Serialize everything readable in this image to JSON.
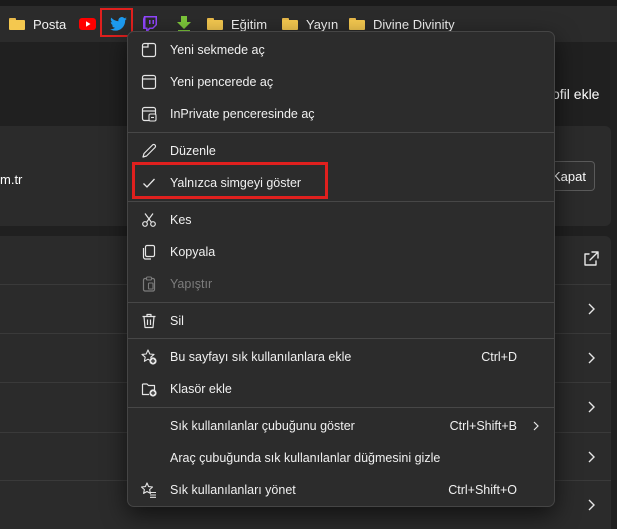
{
  "favorites_bar": {
    "items": [
      {
        "label": "Posta",
        "icon": "folder-icon"
      },
      {
        "label": "",
        "icon": "youtube-icon"
      },
      {
        "label": "",
        "icon": "twitter-icon"
      },
      {
        "label": "",
        "icon": "twitch-icon"
      },
      {
        "label": "",
        "icon": "download-arrow-icon"
      },
      {
        "label": "Eğitim",
        "icon": "folder-icon"
      },
      {
        "label": "Yayın",
        "icon": "folder-icon"
      },
      {
        "label": "Divine Divinity",
        "icon": "folder-icon"
      }
    ]
  },
  "page": {
    "profile_text": "ofil ekle",
    "domain_text": "m.tr",
    "close_button": "Kapat"
  },
  "context_menu": {
    "items": [
      {
        "label": "Yeni sekmede aç",
        "icon": "new-tab-icon",
        "shortcut": "",
        "disabled": false
      },
      {
        "label": "Yeni pencerede aç",
        "icon": "new-window-icon",
        "shortcut": "",
        "disabled": false
      },
      {
        "label": "InPrivate penceresinde aç",
        "icon": "inprivate-icon",
        "shortcut": "",
        "disabled": false
      },
      {
        "label": "Düzenle",
        "icon": "pencil-icon",
        "shortcut": "",
        "disabled": false
      },
      {
        "label": "Yalnızca simgeyi göster",
        "icon": "checkmark-icon",
        "shortcut": "",
        "disabled": false
      },
      {
        "label": "Kes",
        "icon": "scissors-icon",
        "shortcut": "",
        "disabled": false
      },
      {
        "label": "Kopyala",
        "icon": "copy-icon",
        "shortcut": "",
        "disabled": false
      },
      {
        "label": "Yapıştır",
        "icon": "paste-icon",
        "shortcut": "",
        "disabled": true
      },
      {
        "label": "Sil",
        "icon": "trash-icon",
        "shortcut": "",
        "disabled": false
      },
      {
        "label": "Bu sayfayı sık kullanılanlara ekle",
        "icon": "add-favorite-icon",
        "shortcut": "Ctrl+D",
        "disabled": false
      },
      {
        "label": "Klasör ekle",
        "icon": "add-folder-icon",
        "shortcut": "",
        "disabled": false
      },
      {
        "label": "Sık kullanılanlar çubuğunu göster",
        "icon": "",
        "shortcut": "Ctrl+Shift+B",
        "disabled": false
      },
      {
        "label": "Araç çubuğunda sık kullanılanlar düğmesini gizle",
        "icon": "",
        "shortcut": "",
        "disabled": false
      },
      {
        "label": "Sık kullanılanları yönet",
        "icon": "manage-favorites-icon",
        "shortcut": "Ctrl+Shift+O",
        "disabled": false
      }
    ]
  },
  "colors": {
    "highlight": "#e0201e",
    "twitter": "#1d9bf0",
    "youtube": "#ff0000",
    "twitch": "#9146ff",
    "download": "#7cc53a",
    "folder": "#f4c84f"
  }
}
